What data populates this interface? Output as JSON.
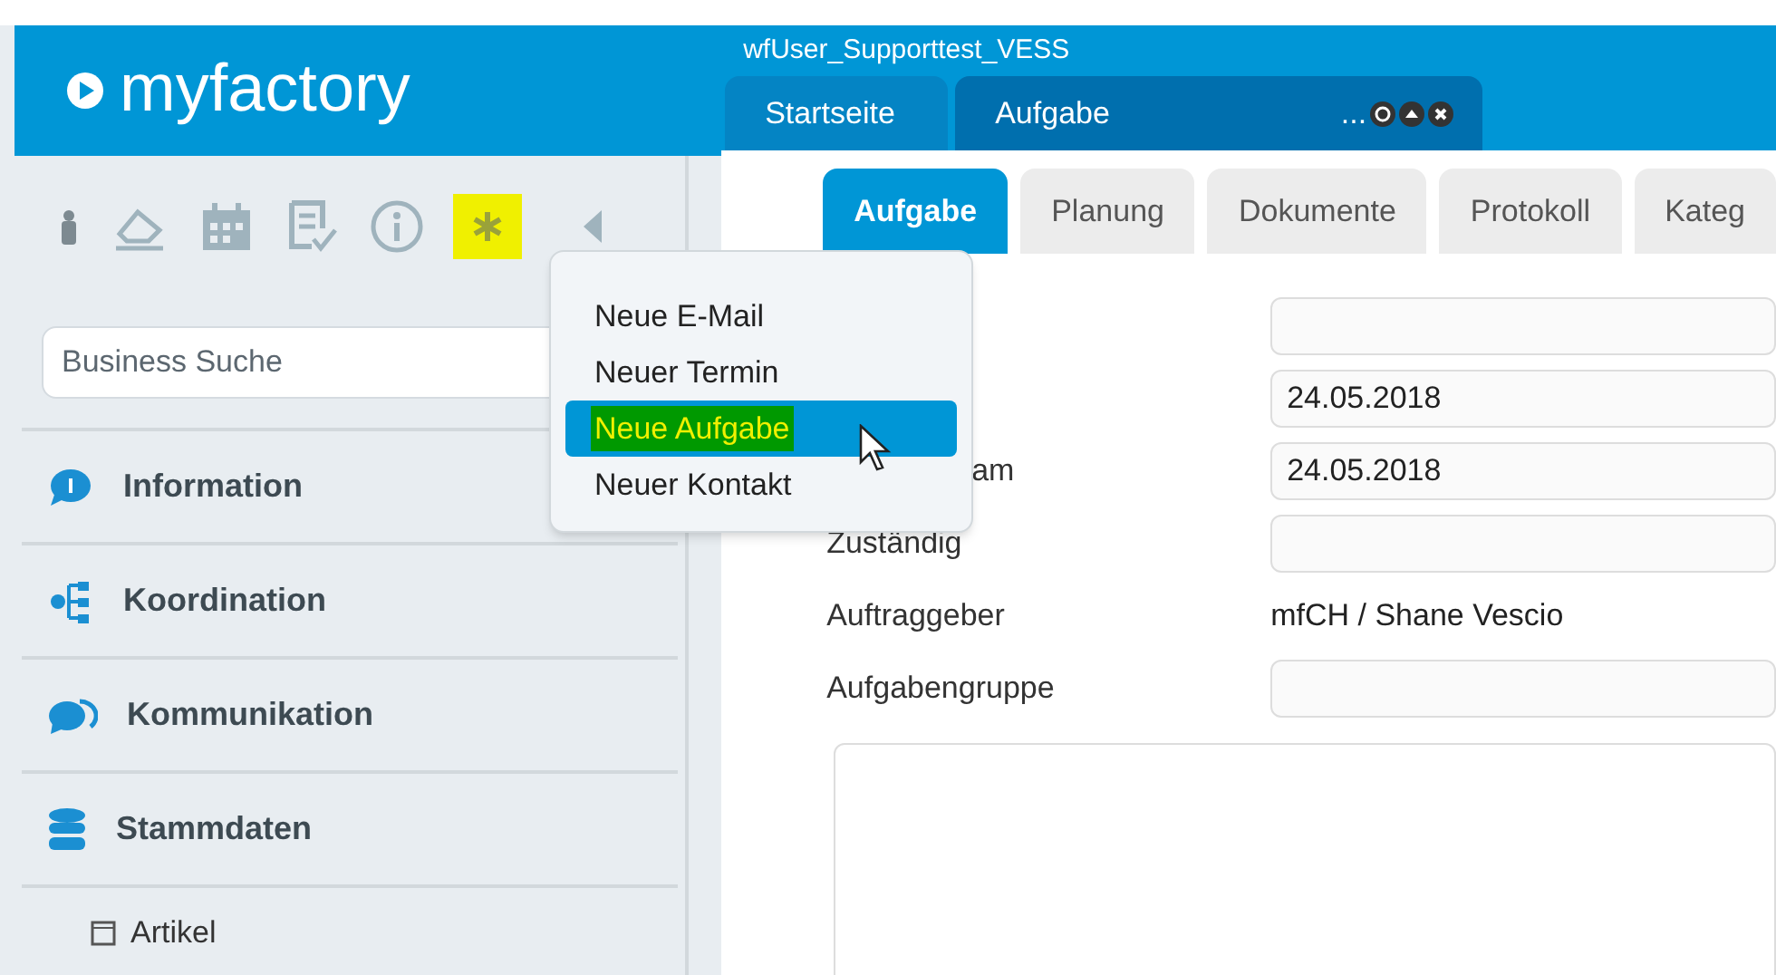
{
  "logo": {
    "text": "myfactory"
  },
  "toolbar": [
    {
      "kind": "user",
      "highlighted": false
    },
    {
      "kind": "eraser",
      "highlighted": false
    },
    {
      "kind": "calendar",
      "highlighted": false
    },
    {
      "kind": "tasklist",
      "highlighted": false
    },
    {
      "kind": "info",
      "highlighted": false
    },
    {
      "kind": "star",
      "highlighted": true
    },
    {
      "kind": "collapse",
      "highlighted": false
    }
  ],
  "search": {
    "placeholder": "Business Suche"
  },
  "sidebar": {
    "items": [
      {
        "label": "Information",
        "kind": "info"
      },
      {
        "label": "Koordination",
        "kind": "tree"
      },
      {
        "label": "Kommunikation",
        "kind": "chat"
      },
      {
        "label": "Stammdaten",
        "kind": "database"
      }
    ],
    "sub_items": [
      {
        "label": "Artikel"
      }
    ]
  },
  "window": {
    "title": "wfUser_Supporttest_VESS"
  },
  "tabs": [
    {
      "label": "Startseite",
      "selected": false
    },
    {
      "label": "Aufgabe",
      "selected": true,
      "suffix": "..."
    }
  ],
  "subtabs": [
    {
      "label": "Aufgabe",
      "selected": true
    },
    {
      "label": "Planung",
      "selected": false
    },
    {
      "label": "Dokumente",
      "selected": false
    },
    {
      "label": "Protokoll",
      "selected": false
    },
    {
      "label": "Kateg",
      "selected": false
    }
  ],
  "form": [
    {
      "kind": "input"
    },
    {
      "kind": "input",
      "value": "24.05.2018"
    },
    {
      "kind": "input",
      "label": "am",
      "partial": true,
      "value": "24.05.2018"
    },
    {
      "kind": "input",
      "label": "Zuständig"
    },
    {
      "kind": "text",
      "label": "Auftraggeber",
      "value": "mfCH / Shane Vescio"
    },
    {
      "kind": "input",
      "label": "Aufgabengruppe"
    },
    {
      "kind": "textarea"
    }
  ],
  "menu": [
    {
      "label": "Neue E-Mail",
      "selected": false
    },
    {
      "label": "Neuer Termin",
      "selected": false
    },
    {
      "label": "Neue Aufgabe",
      "selected": true
    },
    {
      "label": "Neuer Kontakt",
      "selected": false
    }
  ]
}
